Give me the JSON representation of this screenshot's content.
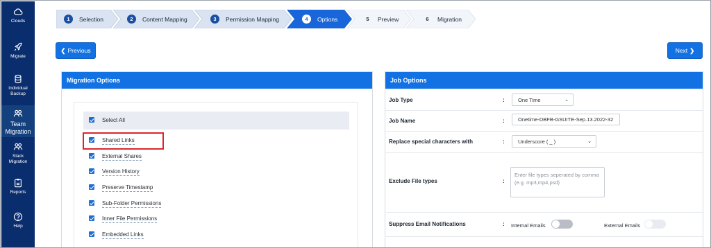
{
  "sidebar": {
    "items": [
      {
        "label": "Clouds",
        "icon": "cloud-icon"
      },
      {
        "label": "Migrate",
        "icon": "rocket-icon"
      },
      {
        "label": "Individual Backup",
        "icon": "database-icon"
      },
      {
        "label": "Team Migration",
        "icon": "team-icon"
      },
      {
        "label": "Slack Migration",
        "icon": "team-icon"
      },
      {
        "label": "Reports",
        "icon": "clipboard-icon"
      },
      {
        "label": "Help",
        "icon": "help-icon"
      }
    ]
  },
  "steps": [
    {
      "num": "1",
      "label": "Selection"
    },
    {
      "num": "2",
      "label": "Content Mapping"
    },
    {
      "num": "3",
      "label": "Permission Mapping"
    },
    {
      "num": "4",
      "label": "Options"
    },
    {
      "num": "5",
      "label": "Preview"
    },
    {
      "num": "6",
      "label": "Migration"
    }
  ],
  "nav": {
    "previous": "Previous",
    "next": "Next"
  },
  "migration_options": {
    "title": "Migration Options",
    "select_all": "Select All",
    "items": [
      "Shared Links",
      "External Shares",
      "Version History",
      "Preserve Timestamp",
      "Sub-Folder Permissions",
      "Inner File Permissions",
      "Embedded Links"
    ]
  },
  "job_options": {
    "title": "Job Options",
    "job_type": {
      "label": "Job Type",
      "value": "One Time"
    },
    "job_name": {
      "label": "Job Name",
      "value": "Onetime-DBFB-GSUITE-Sep.13.2022-32"
    },
    "replace": {
      "label": "Replace special characters with",
      "value": "Underscore ( _ )"
    },
    "exclude": {
      "label": "Exclude File types",
      "placeholder": "Enter file types seperated by comma (e.g. mp3,mp4,psd)"
    },
    "suppress": {
      "label": "Suppress Email Notifications",
      "internal": "Internal Emails",
      "external": "External Emails"
    },
    "colon": ":"
  },
  "colors": {
    "sidebar": "#0a2d6e",
    "accent": "#1372e3",
    "highlight": "#d9262b"
  }
}
